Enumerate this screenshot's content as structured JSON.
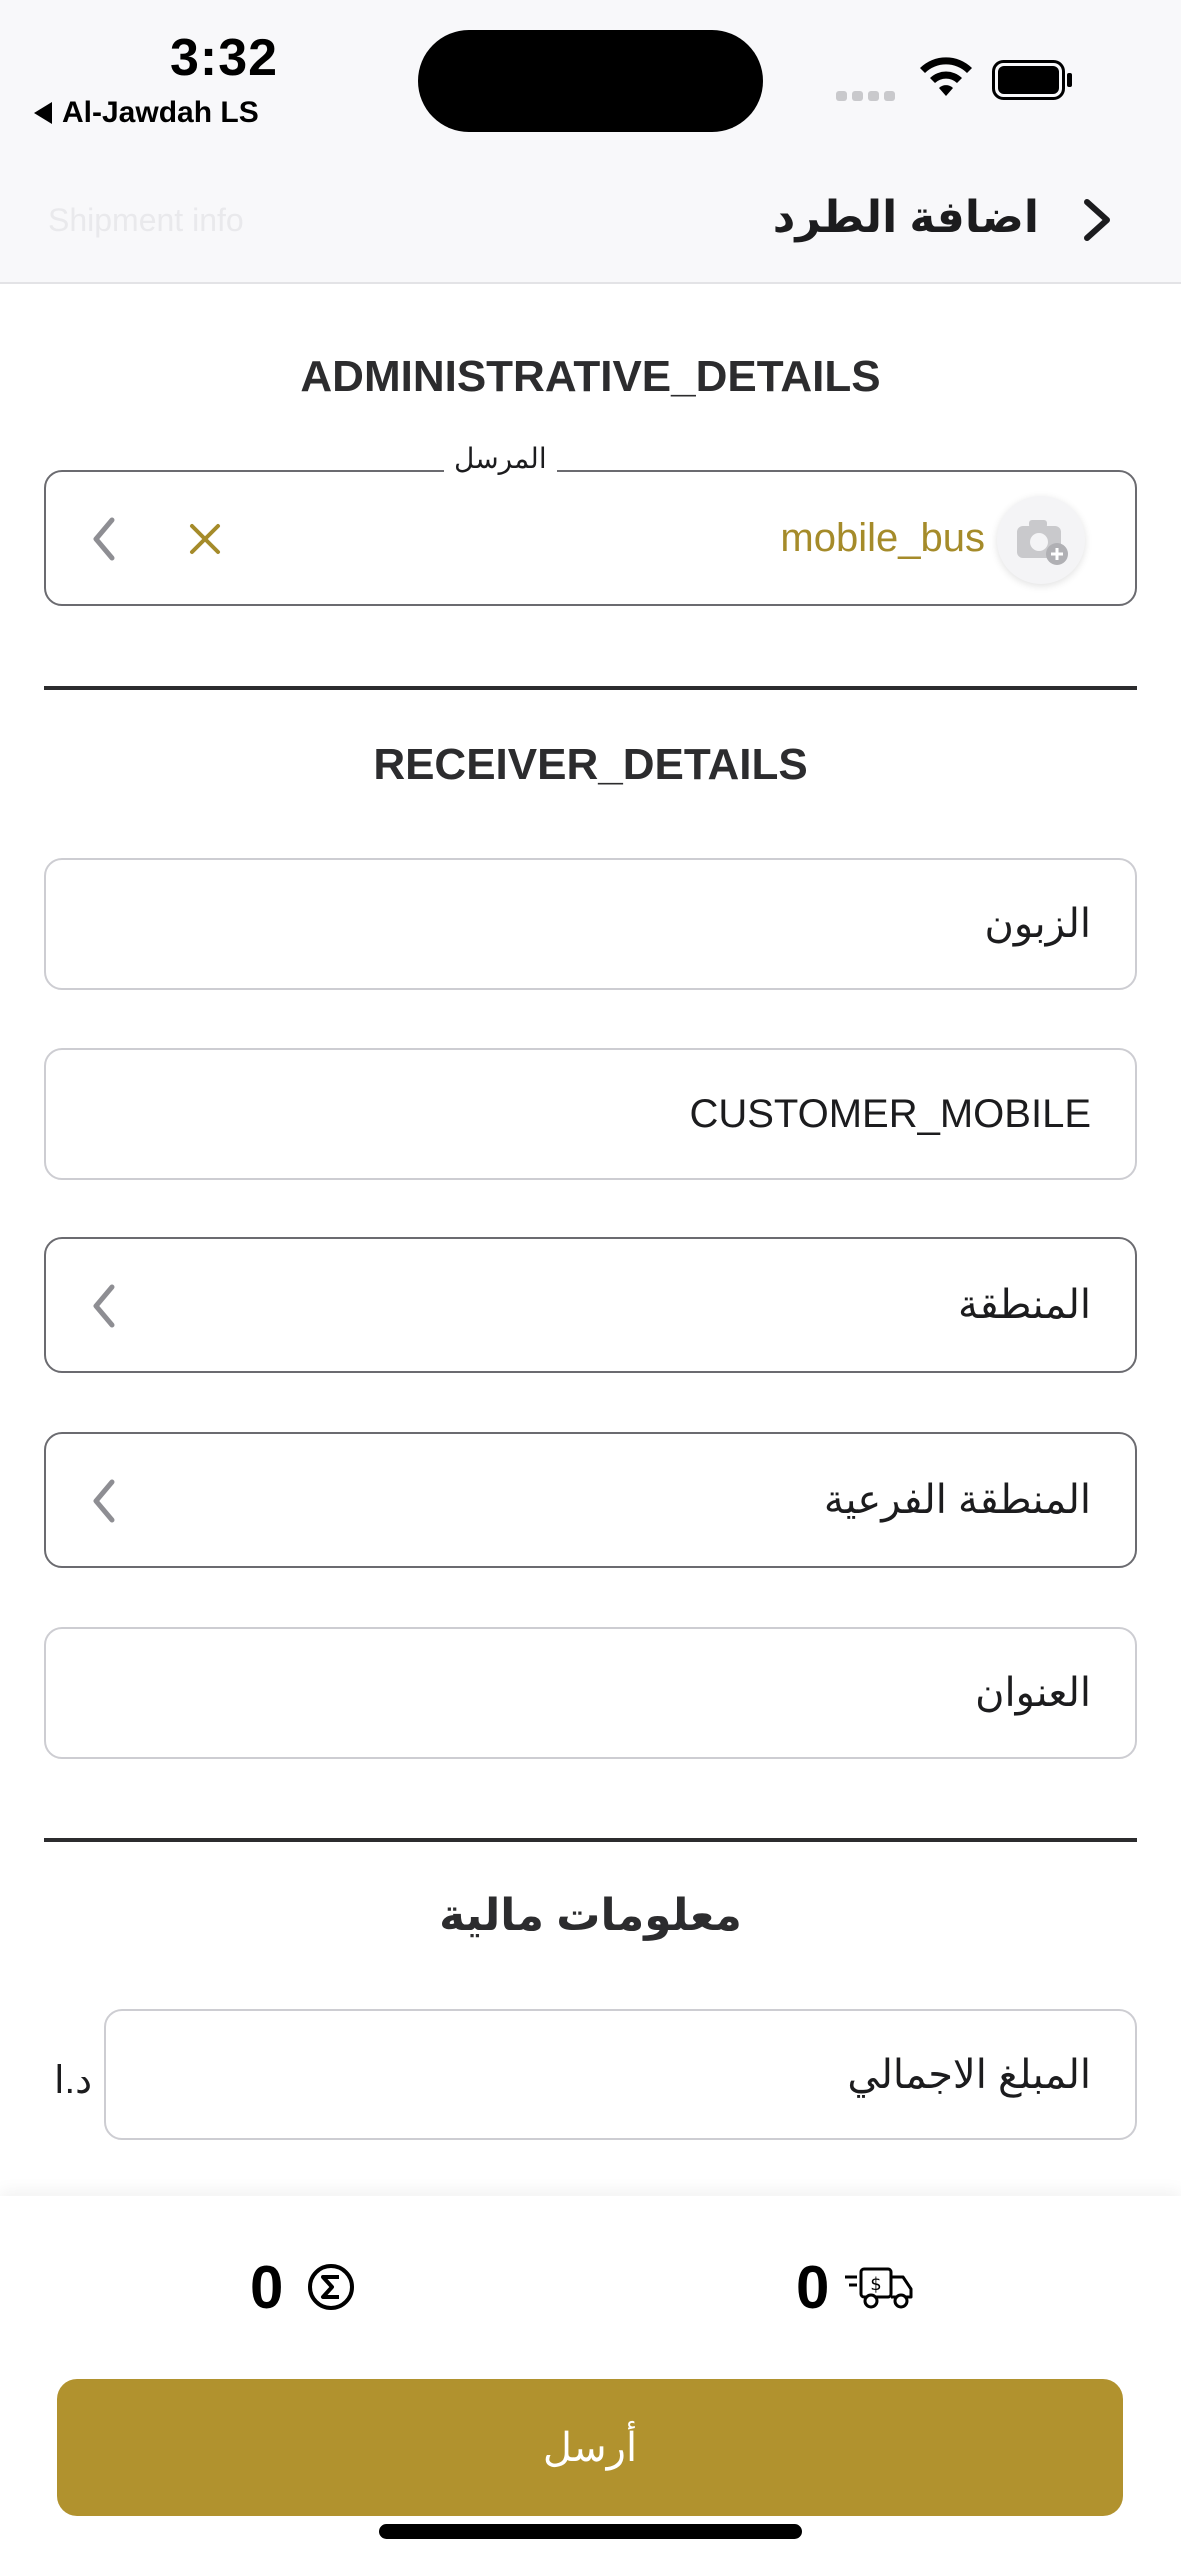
{
  "status_bar": {
    "time": "3:32",
    "back_app": "Al-Jawdah LS"
  },
  "nav": {
    "title": "اضافة الطرد",
    "ghost_text": "Shipment info"
  },
  "administrative": {
    "title": "ADMINISTRATIVE_DETAILS",
    "sender_label": "المرسل",
    "sender_value": "mobile_bus"
  },
  "receiver": {
    "title": "RECEIVER_DETAILS",
    "customer_placeholder": "الزبون",
    "mobile_placeholder": "CUSTOMER_MOBILE",
    "region_placeholder": "المنطقة",
    "subregion_placeholder": "المنطقة الفرعية",
    "address_placeholder": "العنوان"
  },
  "financial": {
    "title": "معلومات مالية",
    "total_amount_placeholder": "المبلغ الاجمالي",
    "currency": "د.ا"
  },
  "footer": {
    "total_count": "0",
    "delivery_count": "0",
    "submit_label": "أرسل"
  },
  "colors": {
    "accent": "#b1922e",
    "sender_text": "#a58b2a"
  }
}
